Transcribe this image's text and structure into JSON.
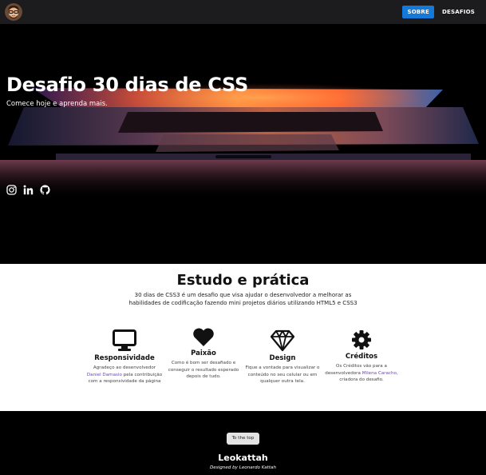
{
  "nav": {
    "avatar_icon": "cartoon-avatar-icon",
    "sobre_label": "SOBRE",
    "desafios_label": "DESAFIOS",
    "accent": "#1479d8"
  },
  "hero": {
    "title": "Desafio 30 dias de CSS",
    "subtitle": "Comece hoje e aprenda mais.",
    "socials": [
      "instagram-icon",
      "linkedin-icon",
      "github-icon"
    ]
  },
  "about": {
    "title": "Estudo e prática",
    "text": "30 dias de CSS3 é um desafio que visa ajudar o desenvolvedor a melhorar as habilidades de codificação fazendo mini projetos diários utilizando HTML5 e CSS3",
    "features": [
      {
        "icon": "monitor-icon",
        "title": "Responsividade",
        "text_before": "Agradeço ao desenvolvedor",
        "link": "Daniel Damasio",
        "text_after": "pela contribuição com a responsividade da página"
      },
      {
        "icon": "heart-icon",
        "title": "Paixão",
        "text": "Como é bom ser desafiado e conseguir o resultado esperado depois de tudo."
      },
      {
        "icon": "diamond-icon",
        "title": "Design",
        "text": "Fique a vontade para visualizar o conteúdo no seu celular ou em qualquer outra tela."
      },
      {
        "icon": "gear-icon",
        "title": "Créditos",
        "text_before": "Os Créditos vão para a desenvolvedora",
        "link": "Milena Caracho",
        "text_after": ", criadora do desafio."
      }
    ]
  },
  "footer": {
    "to_top_label": "To the top",
    "name": "Leokattah",
    "credit": "Designed by Leonardo Kattah"
  }
}
